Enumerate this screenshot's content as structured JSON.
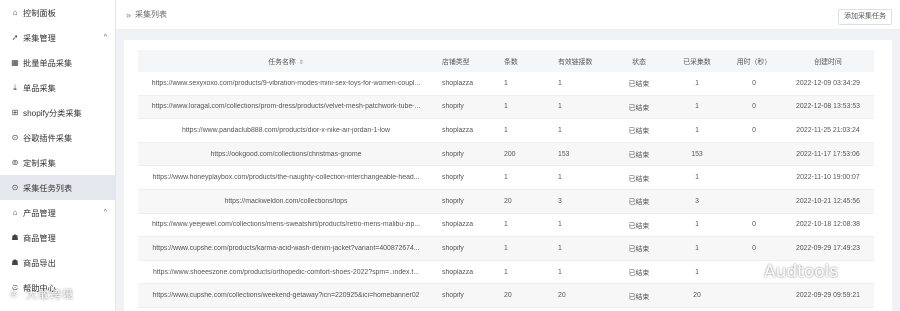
{
  "sidebar": {
    "items": [
      {
        "icon": "home-icon",
        "glyph": "⌂",
        "label": "控制面板"
      },
      {
        "icon": "send-icon",
        "glyph": "➚",
        "label": "采集管理",
        "chevron": "^"
      },
      {
        "icon": "grid-icon",
        "glyph": "▦",
        "label": "批量单品采集"
      },
      {
        "icon": "download-icon",
        "glyph": "⤓",
        "label": "单品采集"
      },
      {
        "icon": "category-icon",
        "glyph": "⊞",
        "label": "shopify分类采集"
      },
      {
        "icon": "plugin-icon",
        "glyph": "⊙",
        "label": "谷歌插件采集"
      },
      {
        "icon": "location-icon",
        "glyph": "⊚",
        "label": "定制采集"
      },
      {
        "icon": "clock-icon",
        "glyph": "⊙",
        "label": "采集任务列表"
      },
      {
        "icon": "product-icon",
        "glyph": "⌂",
        "label": "产品管理",
        "chevron": "^"
      },
      {
        "icon": "goods-icon",
        "glyph": "☗",
        "label": "商品管理"
      },
      {
        "icon": "export-icon",
        "glyph": "☗",
        "label": "商品导出"
      },
      {
        "icon": "help-icon",
        "glyph": "⊙",
        "label": "帮助中心"
      }
    ]
  },
  "header": {
    "breadcrumb": "采集列表",
    "add_button": "添加采集任务"
  },
  "table": {
    "columns": [
      "任务名称",
      "店铺类型",
      "条数",
      "有效链接数",
      "状态",
      "已采集数",
      "用时（秒）",
      "创建时间"
    ],
    "rows": [
      [
        "https://www.sexyxoxo.com/products/9-vibration-modes-mini-sex-toys-for-women-coupl...",
        "shoplazza",
        "1",
        "1",
        "已结束",
        "1",
        "0",
        "2022-12-09 03:34:29"
      ],
      [
        "https://www.loragal.com/collections/prom-dress/products/velvet-mesh-patchwork-tube-...",
        "shopify",
        "1",
        "1",
        "已结束",
        "1",
        "0",
        "2022-12-08 13:53:53"
      ],
      [
        "https://www.pandaclub888.com/products/dior-x-nike-air-jordan-1-low",
        "shoplazza",
        "1",
        "1",
        "已结束",
        "1",
        "0",
        "2022-11-25 21:03:24"
      ],
      [
        "https://ookgood.com/collections/christmas-gnome",
        "shopify",
        "200",
        "153",
        "已结束",
        "153",
        "",
        "2022-11-17 17:53:06"
      ],
      [
        "https://www.honeyplaybox.com/products/the-naughty-collection-interchangeable-head...",
        "shopify",
        "1",
        "1",
        "已结束",
        "1",
        "",
        "2022-11-10 19:00:07"
      ],
      [
        "https://mackweldon.com/collections/tops",
        "shopify",
        "20",
        "3",
        "已结束",
        "3",
        "",
        "2022-10-21 12:45:56"
      ],
      [
        "https://www.yeejewel.com/collections/mens-sweatshirt/products/retro-mens-malibu-zip...",
        "shoplazza",
        "1",
        "1",
        "已结束",
        "1",
        "0",
        "2022-10-18 12:08:38"
      ],
      [
        "https://www.cupshe.com/products/karma-acid-wash-denim-jacket?variant=400872674...",
        "shopify",
        "1",
        "1",
        "已结束",
        "1",
        "0",
        "2022-09-29 17:49:23"
      ],
      [
        "https://www.shoeeszone.com/products/orthopedic-comfort-shoes-2022?spm=..index.f...",
        "shoplazza",
        "1",
        "1",
        "已结束",
        "1",
        "",
        ""
      ],
      [
        "https://www.cupshe.com/collections/weekend-getaway?icn=220925&ici=homebanner02",
        "shopify",
        "20",
        "20",
        "已结束",
        "20",
        "",
        "2022-09-29 09:59:21"
      ]
    ]
  },
  "watermarks": {
    "left": "大敢跨境",
    "right": "Audtools"
  }
}
